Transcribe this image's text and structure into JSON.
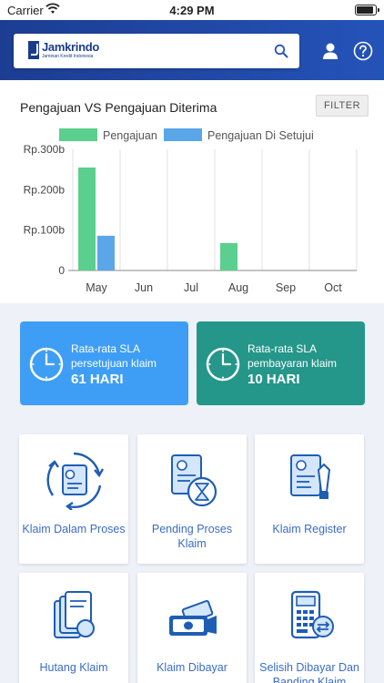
{
  "status_bar": {
    "carrier": "Carrier",
    "time": "4:29 PM"
  },
  "header": {
    "logo_name": "Jamkrindo",
    "logo_tagline": "Jaminan Kredit Indonesia",
    "icons": [
      "search-icon",
      "user-icon",
      "help-icon"
    ]
  },
  "chart": {
    "title": "Pengajuan VS Pengajuan Diterima",
    "filter_label": "FILTER"
  },
  "chart_data": {
    "type": "bar",
    "categories": [
      "May",
      "Jun",
      "Jul",
      "Aug",
      "Sep",
      "Oct"
    ],
    "series": [
      {
        "name": "Pengajuan",
        "values": [
          255,
          0,
          0,
          68,
          0,
          0
        ],
        "color": "#5bcf8e"
      },
      {
        "name": "Pengajuan Di Setujui",
        "values": [
          86,
          0,
          0,
          0,
          0,
          0
        ],
        "color": "#5aa6e9"
      }
    ],
    "y_ticks": [
      {
        "value": 0,
        "label": "0"
      },
      {
        "value": 100,
        "label": "Rp.100b"
      },
      {
        "value": 200,
        "label": "Rp.200b"
      },
      {
        "value": 300,
        "label": "Rp.300b"
      }
    ],
    "ylim": [
      0,
      300
    ],
    "xlabel": "",
    "ylabel": "",
    "grid": "vertical",
    "legend": "top"
  },
  "sla": [
    {
      "line1": "Rata-rata SLA",
      "line2": "persetujuan klaim",
      "value": "61 HARI",
      "color": "#3e9ef5"
    },
    {
      "line1": "Rata-rata SLA",
      "line2": "pembayaran klaim",
      "value": "10 HARI",
      "color": "#25968a"
    }
  ],
  "menu": [
    {
      "label": "Klaim Dalam Proses",
      "icon": "claim-in-process-icon"
    },
    {
      "label": "Pending Proses Klaim",
      "icon": "pending-claim-icon"
    },
    {
      "label": "Klaim Register",
      "icon": "claim-register-icon"
    },
    {
      "label": "Hutang Klaim",
      "icon": "claim-debt-icon"
    },
    {
      "label": "Klaim Dibayar",
      "icon": "claim-paid-icon"
    },
    {
      "label": "Selisih Dibayar Dan Banding Klaim",
      "icon": "claim-difference-icon"
    }
  ],
  "colors": {
    "header": "#1c3d92",
    "accent_blue": "#3e9ef5",
    "accent_green": "#25968a",
    "icon_blue": "#2a6fd0"
  }
}
